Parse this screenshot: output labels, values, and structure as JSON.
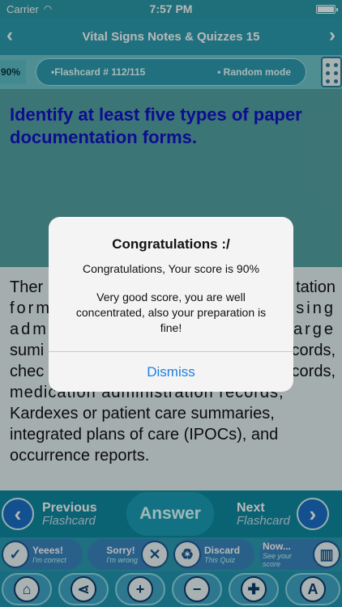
{
  "status": {
    "carrier": "Carrier",
    "wifi_icon": "wifi-icon",
    "time": "7:57 PM",
    "battery_icon": "battery-icon"
  },
  "navbar": {
    "title": "Vital Signs Notes & Quizzes 15",
    "back_icon": "chevron-left-icon",
    "forward_icon": "chevron-right-icon"
  },
  "progress": {
    "percent_label": "90%",
    "flashcard_label": "•Flashcard #  112/115",
    "mode_label": "• Random mode",
    "dice_icon": "dice-icon"
  },
  "question": "Identify at least five types of paper documentation forms.",
  "answer": {
    "lines": [
      "Ther",
      "form",
      "adm",
      "sumi",
      "chec",
      "medication administration records,",
      "Kardexes or patient care summaries,",
      "integrated plans of care (IPOCs), and",
      "occurrence reports."
    ],
    "right_fragments": [
      "tation",
      "rsing",
      "arge",
      "cords,",
      "cords,"
    ]
  },
  "alert": {
    "title": "Congratulations :/",
    "message": "Congratulations, Your score is 90%",
    "detail": "Very good score, you are well concentrated, also your preparation is fine!",
    "dismiss": "Dismiss"
  },
  "toolbar1": {
    "previous": "Previous",
    "previous_sub": "Flashcard",
    "answer": "Answer",
    "next": "Next",
    "next_sub": "Flashcard"
  },
  "toolbar2": {
    "correct": {
      "label": "Yeees!",
      "sub": "I'm correct"
    },
    "wrong": {
      "label": "Sorry!",
      "sub": "I'm wrong"
    },
    "discard": {
      "label": "Discard",
      "sub": "This Quiz"
    },
    "score": {
      "label": "Now...",
      "sub": "See your score"
    }
  },
  "toolbar3": {
    "icons": [
      "home-icon",
      "share-icon",
      "zoom-in-icon",
      "zoom-out-icon",
      "bookmark-icon",
      "font-icon"
    ]
  },
  "colors": {
    "accent": "#2c9db0",
    "question_text": "#1212c8",
    "alert_button": "#1d7fe0"
  }
}
